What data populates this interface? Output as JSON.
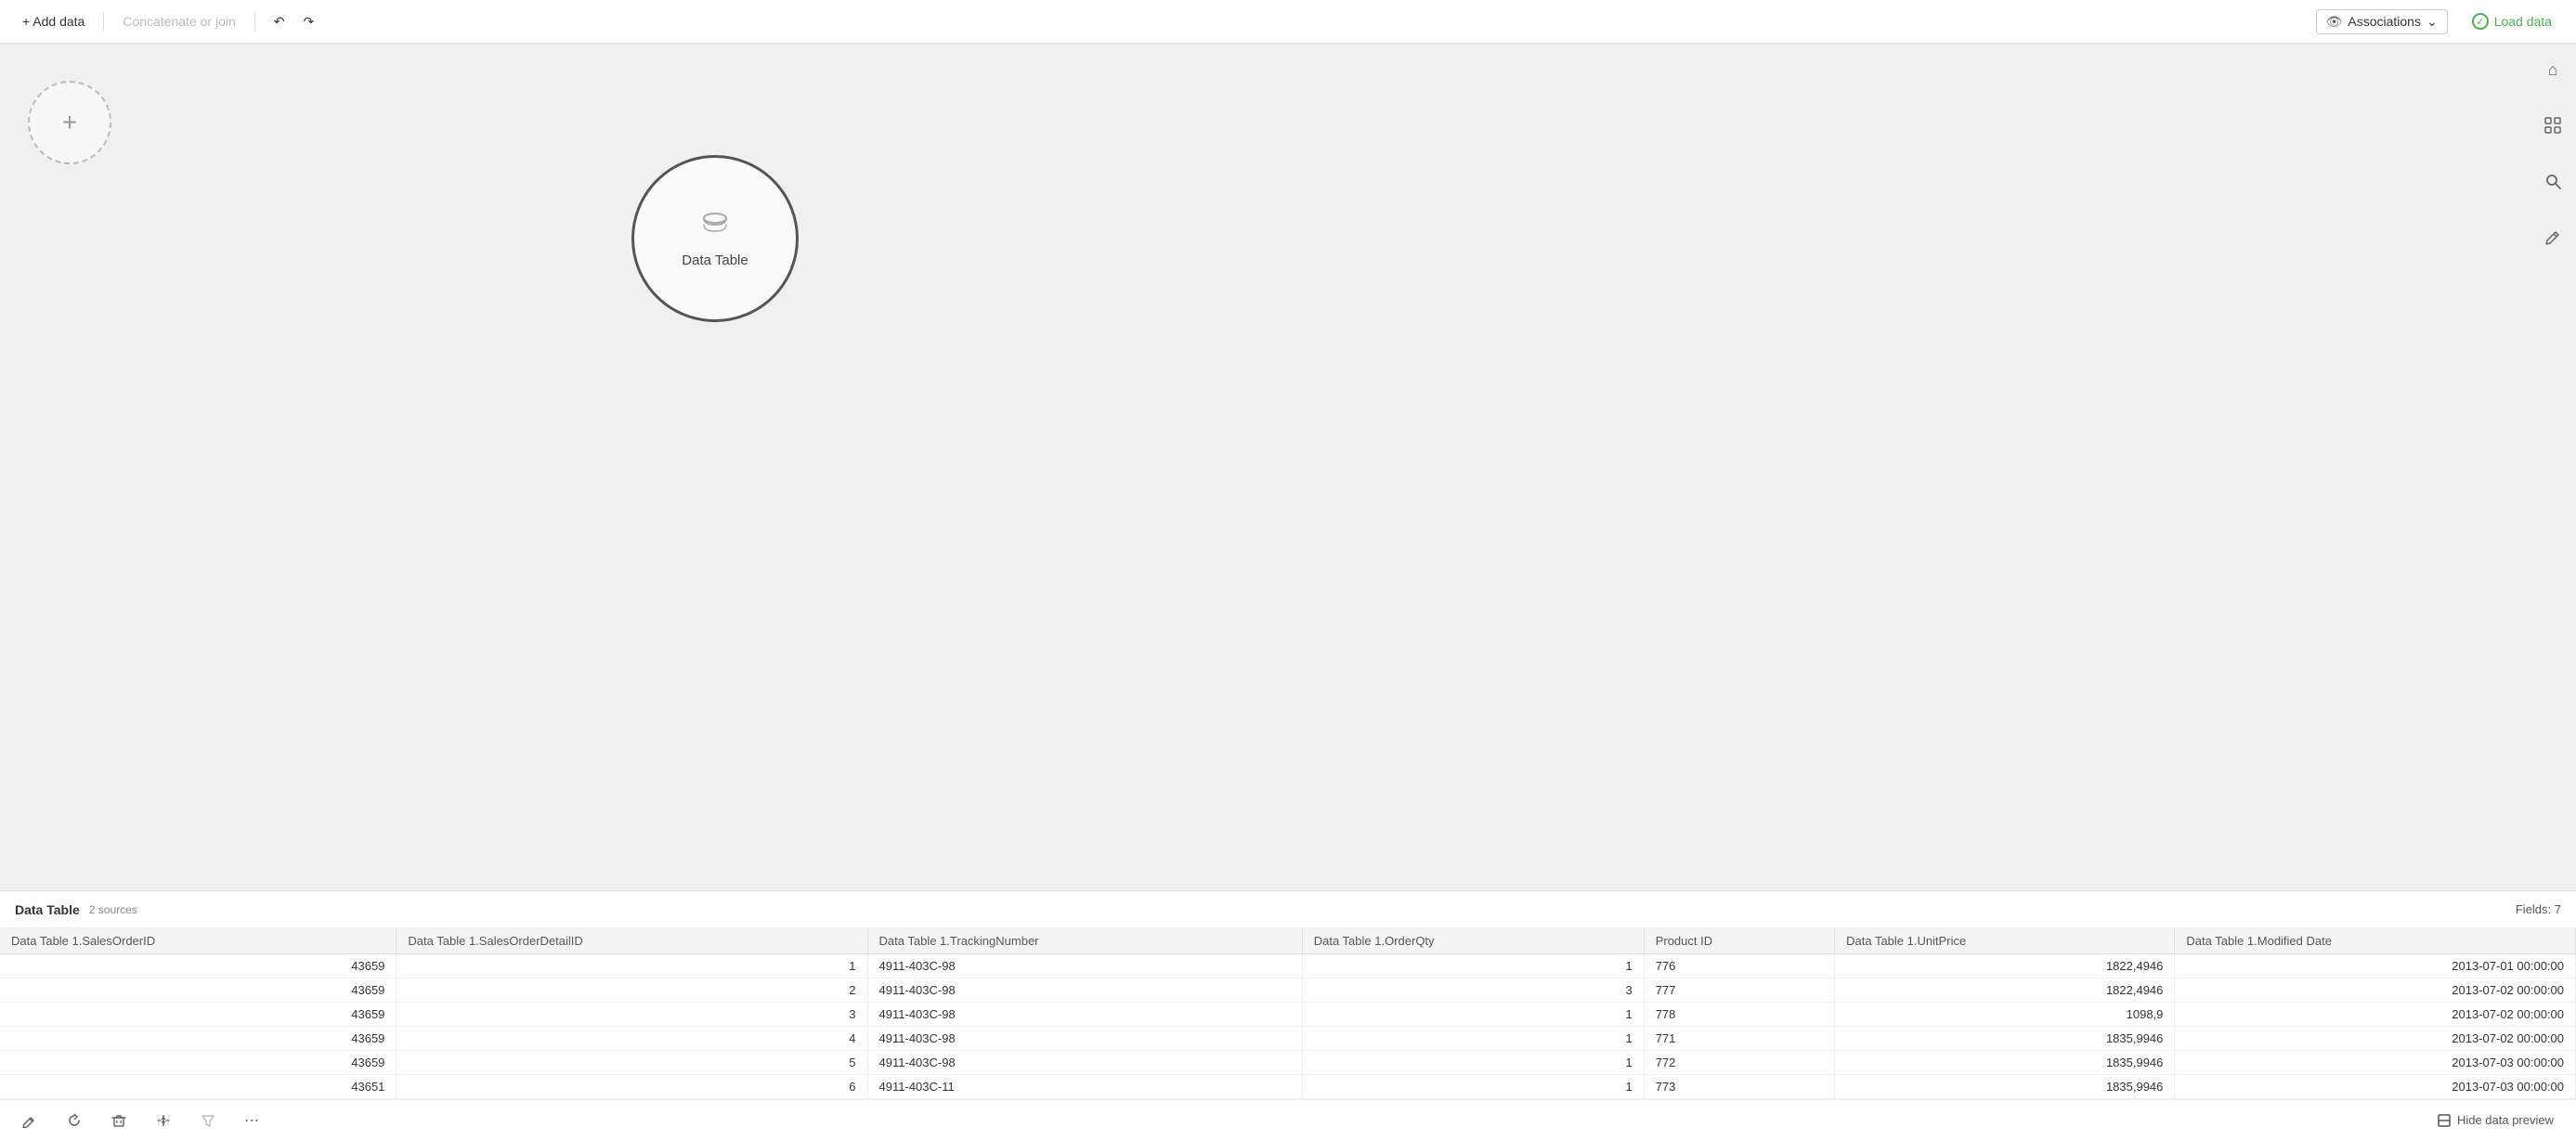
{
  "toolbar": {
    "add_data_label": "+ Add data",
    "concatenate_label": "Concatenate or join",
    "undo_title": "Undo",
    "redo_title": "Redo",
    "associations_label": "Associations",
    "load_data_label": "Load data"
  },
  "canvas": {
    "add_circle_icon": "+",
    "node": {
      "label": "Data Table",
      "icon": "⊙"
    }
  },
  "right_sidebar": {
    "home_icon": "⌂",
    "grid_icon": "⊞",
    "search_icon": "🔍",
    "edit_icon": "✏"
  },
  "bottom_panel": {
    "title": "Data Table",
    "sources": "2 sources",
    "fields_label": "Fields: 7",
    "columns": [
      "Data Table 1.SalesOrderID",
      "Data Table 1.SalesOrderDetailID",
      "Data Table 1.TrackingNumber",
      "Data Table 1.OrderQty",
      "Product ID",
      "Data Table 1.UnitPrice",
      "Data Table 1.Modified Date"
    ],
    "rows": [
      [
        "43659",
        "1",
        "4911-403C-98",
        "1",
        "776",
        "1822,4946",
        "2013-07-01 00:00:00"
      ],
      [
        "43659",
        "2",
        "4911-403C-98",
        "3",
        "777",
        "1822,4946",
        "2013-07-02 00:00:00"
      ],
      [
        "43659",
        "3",
        "4911-403C-98",
        "1",
        "778",
        "1098,9",
        "2013-07-02 00:00:00"
      ],
      [
        "43659",
        "4",
        "4911-403C-98",
        "1",
        "771",
        "1835,9946",
        "2013-07-02 00:00:00"
      ],
      [
        "43659",
        "5",
        "4911-403C-98",
        "1",
        "772",
        "1835,9946",
        "2013-07-03 00:00:00"
      ],
      [
        "43651",
        "6",
        "4911-403C-11",
        "1",
        "773",
        "1835,9946",
        "2013-07-03 00:00:00"
      ]
    ]
  },
  "bottom_toolbar": {
    "edit_icon_title": "Edit",
    "refresh_icon_title": "Refresh",
    "delete_icon_title": "Delete",
    "split_icon_title": "Split",
    "filter_icon_title": "Filter",
    "more_icon_title": "More options",
    "hide_preview_label": "Hide data preview"
  }
}
